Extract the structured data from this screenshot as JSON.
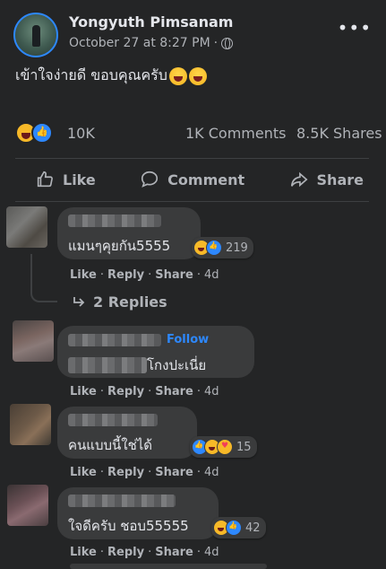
{
  "post": {
    "author": "Yongyuth Pimsanam",
    "timestamp": "October 27 at 8:27 PM",
    "separator": "·",
    "more_label": "•••",
    "text": "เข้าใจง่ายดี ขอบคุณครับ"
  },
  "stats": {
    "reactions": "10K",
    "comments": "1K Comments",
    "shares": "8.5K Shares"
  },
  "actions": {
    "like": "Like",
    "comment": "Comment",
    "share": "Share"
  },
  "comments": [
    {
      "text": "แมนๆคุยกัน5555",
      "reaction_count": "219",
      "like": "Like",
      "reply": "Reply",
      "share": "Share",
      "sep": "·",
      "time": "4d"
    },
    {
      "text": "โกงปะเนี่ย",
      "follow": "Follow",
      "like": "Like",
      "reply": "Reply",
      "share": "Share",
      "sep": "·",
      "time": "4d"
    },
    {
      "text": "คนแบบนี้ใช่ได้",
      "reaction_count": "15",
      "like": "Like",
      "reply": "Reply",
      "share": "Share",
      "sep": "·",
      "time": "4d"
    },
    {
      "text": "ใจดีครับ ชอบ55555",
      "reaction_count": "42",
      "like": "Like",
      "reply": "Reply",
      "share": "Share",
      "sep": "·",
      "time": "4d"
    }
  ],
  "replies_label": "2 Replies",
  "colors": {
    "background": "#242526",
    "bubble": "#3a3b3c",
    "text": "#e4e6eb",
    "muted": "#b0b3b8",
    "accent": "#2d88ff"
  },
  "icons": [
    "globe-icon",
    "more-icon",
    "haha-icon",
    "like-icon",
    "love-icon",
    "care-icon",
    "comment-icon",
    "share-icon",
    "reply-arrow-icon"
  ]
}
